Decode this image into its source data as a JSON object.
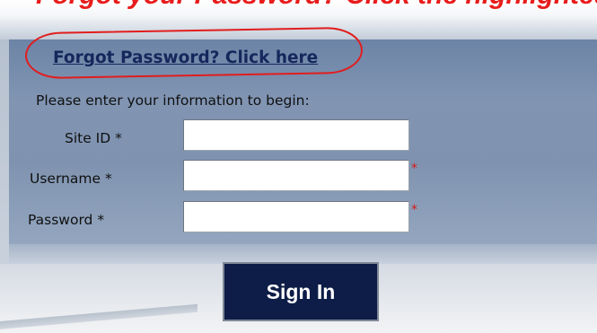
{
  "annotation": {
    "heading": "Forgot your Password? Click the highlighted link"
  },
  "login": {
    "forgot_link": "Forgot Password? Click here",
    "instruction": "Please enter your information to begin:",
    "fields": [
      {
        "label": "Site ID *",
        "value": "",
        "required_marker": ""
      },
      {
        "label": "Username *",
        "value": "",
        "required_marker": "*"
      },
      {
        "label": "Password *",
        "value": "",
        "required_marker": "*"
      }
    ],
    "signin_label": "Sign In"
  },
  "colors": {
    "annotation_red": "#e81c1c",
    "link_navy": "#16275c",
    "button_navy": "#0d1d47",
    "required_red": "#d41a1a"
  }
}
